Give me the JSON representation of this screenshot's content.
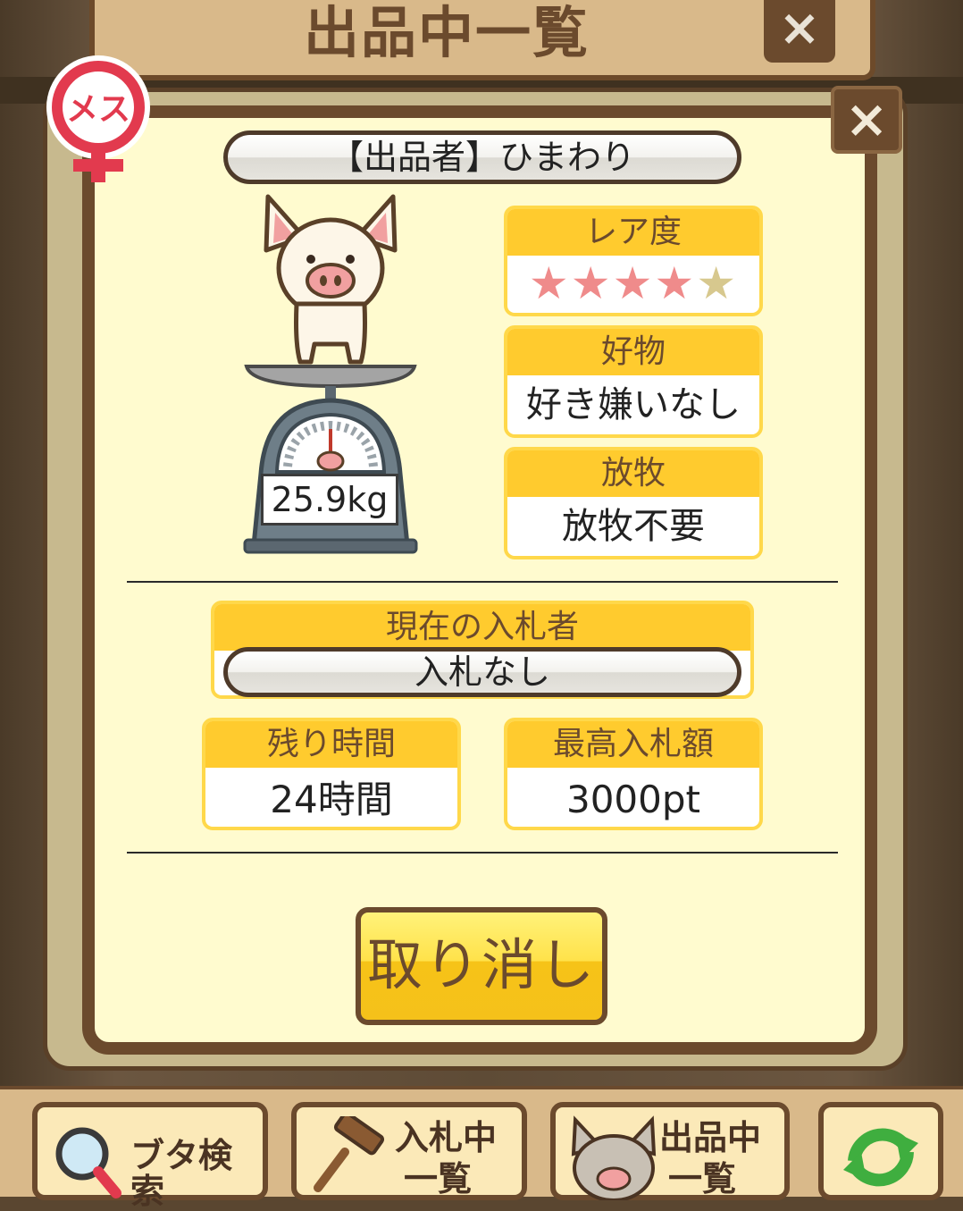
{
  "screen_title": "出品中一覧",
  "close_glyph": "×",
  "gender_label": "メス",
  "seller": "【出品者】ひまわり",
  "pig": {
    "weight": "25.9kg"
  },
  "rarity": {
    "label": "レア度",
    "stars_filled": 4,
    "stars_total": 5
  },
  "favorite": {
    "label": "好物",
    "value": "好き嫌いなし"
  },
  "pasture": {
    "label": "放牧",
    "value": "放牧不要"
  },
  "bidder": {
    "label": "現在の入札者",
    "value": "入札なし"
  },
  "remaining": {
    "label": "残り時間",
    "value": "24時間"
  },
  "highest_bid": {
    "label": "最高入札額",
    "value": "3000pt"
  },
  "cancel_button": "取り消し",
  "toolbar": {
    "search": "ブタ検索",
    "bidding_line1": "入札中",
    "bidding_line2": "一覧",
    "listing_line1": "出品中",
    "listing_line2": "一覧"
  },
  "colors": {
    "accent": "#ffcb2e",
    "frame": "#6b4a2d",
    "panel": "#fffbcf",
    "star_on": "#ef8b8b",
    "star_off": "#d7c88e"
  }
}
